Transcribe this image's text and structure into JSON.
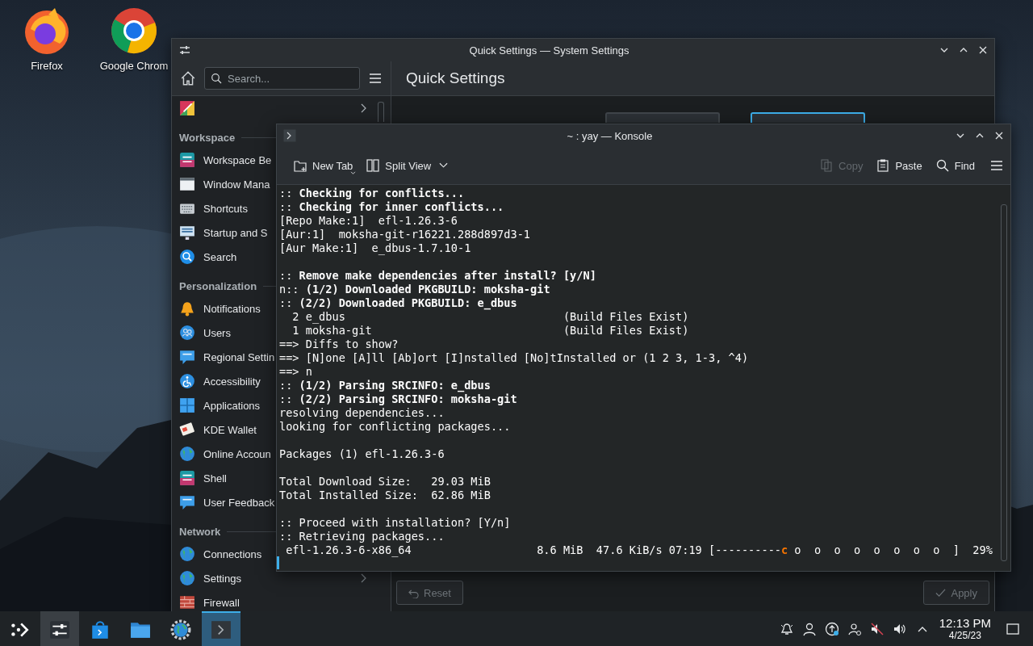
{
  "desktop_icons": [
    {
      "label": "Firefox"
    },
    {
      "label": "Google Chrom"
    }
  ],
  "settings_window": {
    "title": "Quick Settings — System Settings",
    "search": {
      "placeholder": "Search..."
    },
    "sections": [
      {
        "title": "Workspace",
        "items": [
          {
            "label": "Workspace Be",
            "expandable": false
          },
          {
            "label": "Window Mana",
            "expandable": false
          },
          {
            "label": "Shortcuts",
            "expandable": false
          },
          {
            "label": "Startup and S",
            "expandable": false
          },
          {
            "label": "Search",
            "expandable": false
          }
        ]
      },
      {
        "title": "Personalization",
        "items": [
          {
            "label": "Notifications",
            "expandable": false
          },
          {
            "label": "Users",
            "expandable": false
          },
          {
            "label": "Regional Settin",
            "expandable": false
          },
          {
            "label": "Accessibility",
            "expandable": false
          },
          {
            "label": "Applications",
            "expandable": false
          },
          {
            "label": "KDE Wallet",
            "expandable": false
          },
          {
            "label": "Online Accoun",
            "expandable": false
          },
          {
            "label": "Shell",
            "expandable": false
          },
          {
            "label": "User Feedback",
            "expandable": false
          }
        ]
      },
      {
        "title": "Network",
        "items": [
          {
            "label": "Connections",
            "expandable": false
          },
          {
            "label": "Settings",
            "expandable": true
          },
          {
            "label": "Firewall",
            "expandable": false
          }
        ]
      }
    ],
    "page_title": "Quick Settings",
    "previews": [
      {
        "selected": false
      },
      {
        "selected": true
      }
    ],
    "buttons": [
      {
        "label": "Reset",
        "disabled": true
      },
      {
        "label": "Apply",
        "disabled": true
      }
    ]
  },
  "konsole": {
    "title": "~ : yay — Konsole",
    "toolbar": [
      {
        "label": "New Tab",
        "disabled": false
      },
      {
        "label": "Split View",
        "disabled": false
      },
      {
        "label": "Copy",
        "disabled": true
      },
      {
        "label": "Paste",
        "disabled": false
      },
      {
        "label": "Find",
        "disabled": false
      }
    ],
    "blocks": [
      [
        ":: **Checking for conflicts...**",
        ":: **Checking for inner conflicts...**",
        "[Repo Make:1]  efl-1.26.3-6",
        "[Aur:1]  moksha-git-r16221.288d897d3-1",
        "[Aur Make:1]  e_dbus-1.7.10-1"
      ],
      [
        ":: **Remove make dependencies after install? [y/N]**",
        "n:: **(1/2) Downloaded PKGBUILD: moksha-git**",
        ":: **(2/2) Downloaded PKGBUILD: e_dbus**",
        "  2 e_dbus                                 (Build Files Exist)",
        "  1 moksha-git                             (Build Files Exist)",
        "==> Diffs to show?",
        "==> [N]one [A]ll [Ab]ort [I]nstalled [No]tInstalled or (1 2 3, 1-3, ^4)",
        "==> n",
        ":: **(1/2) Parsing SRCINFO: e_dbus**",
        ":: **(2/2) Parsing SRCINFO: moksha-git**",
        "resolving dependencies...",
        "looking for conflicting packages..."
      ],
      [
        "Packages (1) efl-1.26.3-6"
      ],
      [
        "Total Download Size:   29.03 MiB",
        "Total Installed Size:  62.86 MiB"
      ],
      [
        ":: Proceed with installation? [Y/n]",
        ":: Retrieving packages..."
      ]
    ],
    "progress": {
      "before": " efl-1.26.3-6-x86_64                   8.6 MiB  47.6 KiB/s 07:19 [----------",
      "marker": "c",
      "after": " o  o  o  o  o  o  o  o  ]  29%"
    }
  },
  "taskbar": {
    "apps": [
      {
        "open": false,
        "selected": false
      },
      {
        "open": true,
        "selected": false
      },
      {
        "open": false,
        "selected": false
      },
      {
        "open": false,
        "selected": false
      },
      {
        "open": false,
        "selected": false
      },
      {
        "open": true,
        "selected": true
      }
    ],
    "clock": {
      "time": "12:13 PM",
      "date": "4/25/23"
    }
  }
}
